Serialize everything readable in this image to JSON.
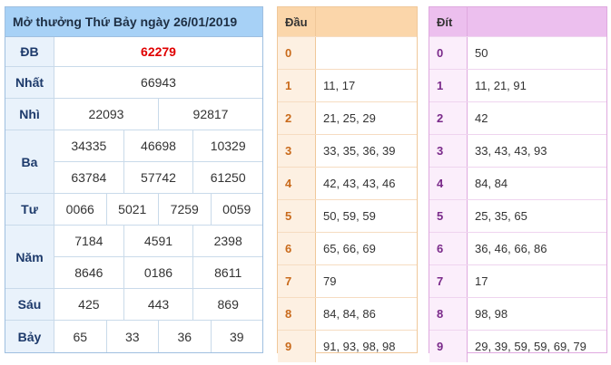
{
  "results": {
    "title": "Mở thưởng Thứ Bảy ngày 26/01/2019",
    "prizes": [
      {
        "label": "ĐB",
        "lines": [
          [
            "62279"
          ]
        ]
      },
      {
        "label": "Nhất",
        "lines": [
          [
            "66943"
          ]
        ]
      },
      {
        "label": "Nhì",
        "lines": [
          [
            "22093",
            "92817"
          ]
        ]
      },
      {
        "label": "Ba",
        "lines": [
          [
            "34335",
            "46698",
            "10329"
          ],
          [
            "63784",
            "57742",
            "61250"
          ]
        ]
      },
      {
        "label": "Tư",
        "lines": [
          [
            "0066",
            "5021",
            "7259",
            "0059"
          ]
        ]
      },
      {
        "label": "Năm",
        "lines": [
          [
            "7184",
            "4591",
            "2398"
          ],
          [
            "8646",
            "0186",
            "8611"
          ]
        ]
      },
      {
        "label": "Sáu",
        "lines": [
          [
            "425",
            "443",
            "869"
          ]
        ]
      },
      {
        "label": "Bảy",
        "lines": [
          [
            "65",
            "33",
            "36",
            "39"
          ]
        ]
      }
    ]
  },
  "dau": {
    "header": "Đầu",
    "rows": [
      {
        "d": "0",
        "v": ""
      },
      {
        "d": "1",
        "v": "11, 17"
      },
      {
        "d": "2",
        "v": "21, 25, 29"
      },
      {
        "d": "3",
        "v": "33, 35, 36, 39"
      },
      {
        "d": "4",
        "v": "42, 43, 43, 46"
      },
      {
        "d": "5",
        "v": "50, 59, 59"
      },
      {
        "d": "6",
        "v": "65, 66, 69"
      },
      {
        "d": "7",
        "v": "79"
      },
      {
        "d": "8",
        "v": "84, 84, 86"
      },
      {
        "d": "9",
        "v": "91, 93, 98, 98"
      }
    ]
  },
  "duoi": {
    "header": "Đít",
    "rows": [
      {
        "d": "0",
        "v": "50"
      },
      {
        "d": "1",
        "v": "11, 21, 91"
      },
      {
        "d": "2",
        "v": "42"
      },
      {
        "d": "3",
        "v": "33, 43, 43, 93"
      },
      {
        "d": "4",
        "v": "84, 84"
      },
      {
        "d": "5",
        "v": "25, 35, 65"
      },
      {
        "d": "6",
        "v": "36, 46, 66, 86"
      },
      {
        "d": "7",
        "v": "17"
      },
      {
        "d": "8",
        "v": "98, 98"
      },
      {
        "d": "9",
        "v": "29, 39, 59, 59, 69, 79"
      }
    ]
  },
  "colors": {
    "special_prize": "#e00000",
    "results_header": "#a7d1f6",
    "dau_header": "#fbd6aa",
    "duoi_header": "#ecbfee"
  }
}
